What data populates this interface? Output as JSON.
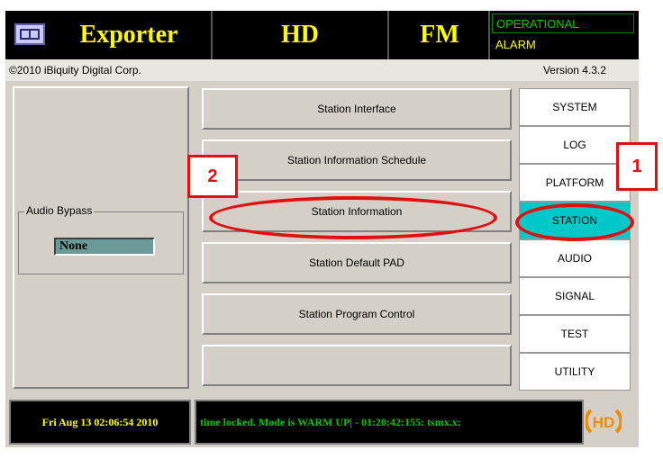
{
  "header": {
    "title_exporter": "Exporter",
    "title_hd": "HD",
    "title_fm": "FM",
    "status_operational": "OPERATIONAL",
    "status_alarm": "ALARM"
  },
  "subheader": {
    "copyright": "©2010 iBiquity Digital Corp.",
    "version": "Version 4.3.2"
  },
  "left_panel": {
    "group_label": "Audio Bypass",
    "bypass_value": "None"
  },
  "menu": {
    "items": [
      "Station Interface",
      "Station Information Schedule",
      "Station Information",
      "Station Default PAD",
      "Station Program Control",
      ""
    ]
  },
  "tabs": {
    "items": [
      "SYSTEM",
      "LOG",
      "PLATFORM",
      "STATION",
      "AUDIO",
      "SIGNAL",
      "TEST",
      "UTILITY"
    ],
    "active": "STATION"
  },
  "footer": {
    "datetime": "Fri Aug 13 02:06:54 2010",
    "log_message": "time locked. Mode is WARM UP|  -  01:20:42:155: tsmx.x:"
  },
  "annotations": {
    "callout_1": "1",
    "callout_2": "2"
  },
  "colors": {
    "title": "#ffff00",
    "operational": "#00c800",
    "active_tab": "#00c8c8",
    "annotation": "#e01010"
  }
}
